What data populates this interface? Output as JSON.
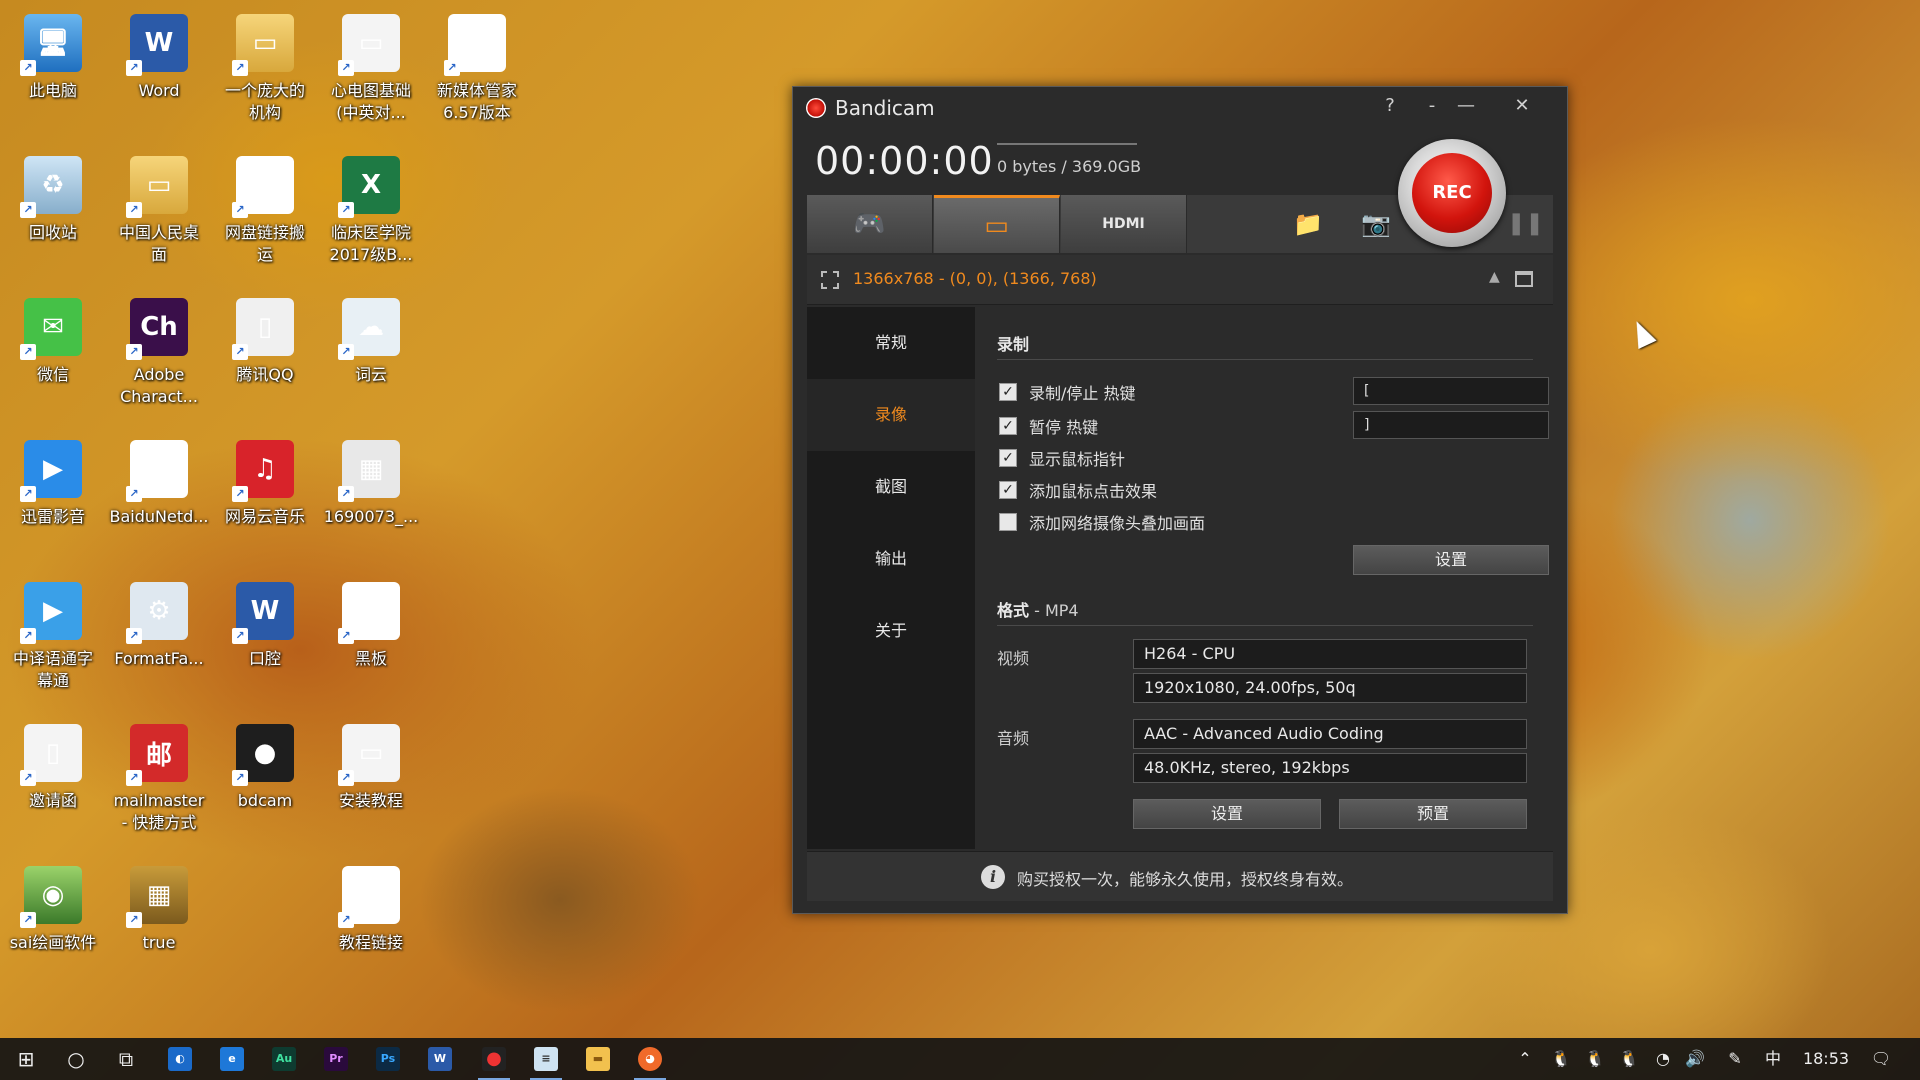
{
  "desktop": {
    "icons": [
      {
        "label": "此电脑",
        "glyph": "🖥"
      },
      {
        "label": "Word",
        "glyph": "W"
      },
      {
        "label": "一个庞大的\n机构",
        "glyph": "▭"
      },
      {
        "label": "心电图基础\n(中英对...",
        "glyph": "▭"
      },
      {
        "label": "新媒体管家\n6.57版本",
        "glyph": "▯"
      },
      {
        "label": "回收站",
        "glyph": "♻"
      },
      {
        "label": "中国人民桌\n面",
        "glyph": "▭"
      },
      {
        "label": "网盘链接搬\n运",
        "glyph": "≡"
      },
      {
        "label": "临床医学院\n2017级B...",
        "glyph": "X"
      },
      {
        "label": "微信",
        "glyph": "✉"
      },
      {
        "label": "Adobe\nCharact...",
        "glyph": "Ch"
      },
      {
        "label": "腾讯QQ",
        "glyph": "▯"
      },
      {
        "label": "词云",
        "glyph": "☁"
      },
      {
        "label": "迅雷影音",
        "glyph": "▶"
      },
      {
        "label": "BaiduNetd...",
        "glyph": "✿"
      },
      {
        "label": "网易云音乐",
        "glyph": "♫"
      },
      {
        "label": "1690073_...",
        "glyph": "▦"
      },
      {
        "label": "中译语通字\n幕通",
        "glyph": "▶"
      },
      {
        "label": "FormatFa...",
        "glyph": "⚙"
      },
      {
        "label": "口腔",
        "glyph": "W"
      },
      {
        "label": "黑板",
        "glyph": "≡"
      },
      {
        "label": "邀请函",
        "glyph": "▯"
      },
      {
        "label": "mailmaster\n- 快捷方式",
        "glyph": "邮"
      },
      {
        "label": "bdcam",
        "glyph": "●"
      },
      {
        "label": "安装教程",
        "glyph": "▭"
      },
      {
        "label": "sai绘画软件",
        "glyph": "◉"
      },
      {
        "label": "true",
        "glyph": "▦"
      },
      {
        "label": "教程链接",
        "glyph": "≡"
      }
    ]
  },
  "window": {
    "title": "Bandicam",
    "help": "?",
    "mini": "-",
    "minimize": "—",
    "close": "✕",
    "timer": "00:00:00",
    "size_readout": "0 bytes / 369.0GB",
    "rec_label": "REC",
    "region": "1366x768 - (0, 0), (1366, 768)",
    "sidebar": [
      "常规",
      "录像",
      "截图",
      "输出",
      "关于"
    ],
    "record_section": "录制",
    "options": [
      {
        "label": "录制/停止 热键",
        "checked": "✓"
      },
      {
        "label": "暂停 热键",
        "checked": "✓"
      },
      {
        "label": "显示鼠标指针",
        "checked": "✓"
      },
      {
        "label": "添加鼠标点击效果",
        "checked": "✓"
      },
      {
        "label": "添加网络摄像头叠加画面",
        "checked": ""
      }
    ],
    "hotkey_record": "[",
    "hotkey_pause": "]",
    "settings_button": "设置",
    "format_label": "格式",
    "format_value": " - MP4",
    "video_label": "视频",
    "video_codec": "H264 - CPU",
    "video_params": "1920x1080, 24.00fps, 50q",
    "audio_label": "音频",
    "audio_codec": "AAC - Advanced Audio Coding",
    "audio_params": "48.0KHz, stereo, 192kbps",
    "format_settings_button": "设置",
    "preset_button": "预置",
    "footer_info": "购买授权一次，能够永久使用，授权终身有效。"
  },
  "taskbar": {
    "clock": "18:53",
    "ime": "中"
  }
}
